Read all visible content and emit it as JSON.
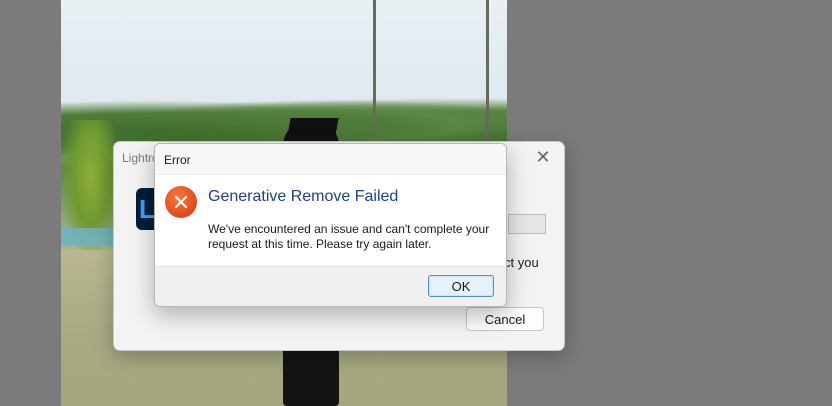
{
  "background_dialog": {
    "title": "Lightro",
    "close_glyph": "✕",
    "logo_text": "Lr",
    "partial_text": "ct you",
    "cancel_label": "Cancel"
  },
  "error_dialog": {
    "title": "Error",
    "heading": "Generative Remove Failed",
    "message": "We've encountered an issue and can't complete your request at this time. Please try again later.",
    "ok_label": "OK",
    "icon": "error-x-icon"
  },
  "colors": {
    "heading": "#1f3f8c",
    "error_icon": "#e55223",
    "ok_border": "#5a8ed6"
  }
}
